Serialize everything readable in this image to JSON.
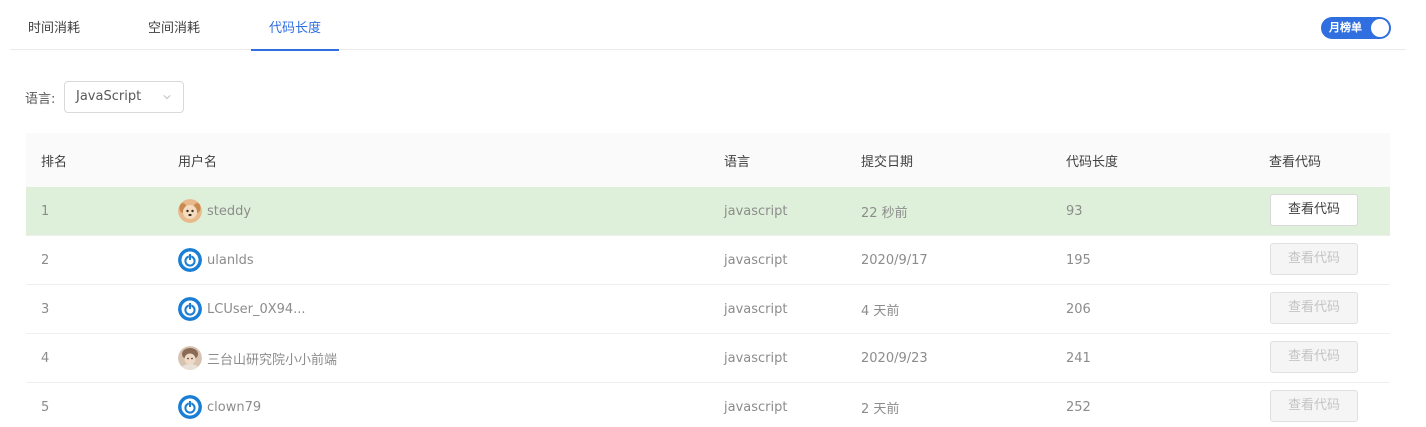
{
  "tabs": [
    {
      "label": "时间消耗"
    },
    {
      "label": "空间消耗"
    },
    {
      "label": "代码长度",
      "active": true
    }
  ],
  "toggle": {
    "label": "月榜单",
    "on": true
  },
  "filter": {
    "label": "语言:",
    "selected": "JavaScript"
  },
  "table": {
    "headers": {
      "rank": "排名",
      "user": "用户名",
      "lang": "语言",
      "date": "提交日期",
      "length": "代码长度",
      "view": "查看代码"
    },
    "rows": [
      {
        "rank": "1",
        "user": "steddy",
        "avatar": "dog-avatar-icon",
        "lang": "javascript",
        "date": "22 秒前",
        "length": "93",
        "view": "查看代码",
        "view_enabled": true
      },
      {
        "rank": "2",
        "user": "ulanlds",
        "avatar": "power-avatar-icon",
        "lang": "javascript",
        "date": "2020/9/17",
        "length": "195",
        "view": "查看代码",
        "view_enabled": false
      },
      {
        "rank": "3",
        "user": "LCUser_0X94...",
        "avatar": "power-avatar-icon",
        "lang": "javascript",
        "date": "4 天前",
        "length": "206",
        "view": "查看代码",
        "view_enabled": false
      },
      {
        "rank": "4",
        "user": "三台山研究院小小前端",
        "avatar": "photo-avatar-icon",
        "lang": "javascript",
        "date": "2020/9/23",
        "length": "241",
        "view": "查看代码",
        "view_enabled": false
      },
      {
        "rank": "5",
        "user": "clown79",
        "avatar": "power-avatar-icon",
        "lang": "javascript",
        "date": "2 天前",
        "length": "252",
        "view": "查看代码",
        "view_enabled": false
      }
    ]
  },
  "colors": {
    "accent": "#2f6fe0",
    "highlight_row": "#dff0da",
    "power_avatar": "#1a7fd4"
  }
}
